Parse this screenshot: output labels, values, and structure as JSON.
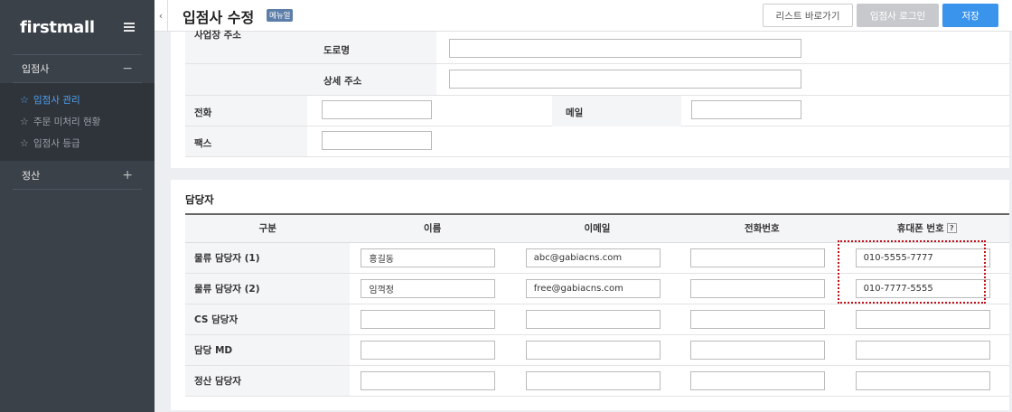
{
  "sidebar": {
    "logo": "firstmall",
    "groups": [
      {
        "label": "입점사",
        "toggle": "−"
      },
      {
        "label": "정산",
        "toggle": "+"
      }
    ],
    "items": [
      {
        "label": "입점사 관리"
      },
      {
        "label": "주문 미처리 현황"
      },
      {
        "label": "입점사 등급"
      }
    ]
  },
  "header": {
    "title": "입점사 수정",
    "badge": "메뉴얼",
    "collapse": "‹",
    "buttons": {
      "list": "리스트 바로가기",
      "login": "입점사 로그인",
      "save": "저장"
    }
  },
  "info": {
    "address_label": "사업장 주소",
    "road_label": "도로명",
    "detail_label": "상세 주소",
    "phone_label": "전화",
    "email_label": "메일",
    "fax_label": "팩스"
  },
  "contacts": {
    "title": "담당자",
    "headers": [
      "구분",
      "이름",
      "이메일",
      "전화번호",
      "휴대폰 번호"
    ],
    "help": "?",
    "rows": [
      {
        "label": "물류 담당자 (1)",
        "name": "홍길동",
        "email": "abc@gabiacns.com",
        "phone": "",
        "mobile": "010-5555-7777"
      },
      {
        "label": "물류 담당자 (2)",
        "name": "임꺽정",
        "email": "free@gabiacns.com",
        "phone": "",
        "mobile": "010-7777-5555"
      },
      {
        "label": "CS 담당자",
        "name": "",
        "email": "",
        "phone": "",
        "mobile": ""
      },
      {
        "label": "담당 MD",
        "name": "",
        "email": "",
        "phone": "",
        "mobile": ""
      },
      {
        "label": "정산 담당자",
        "name": "",
        "email": "",
        "phone": "",
        "mobile": ""
      }
    ]
  },
  "colors": {
    "accent": "#3b94ec",
    "sidebar": "#3b4149",
    "highlight": "#c0101a"
  }
}
